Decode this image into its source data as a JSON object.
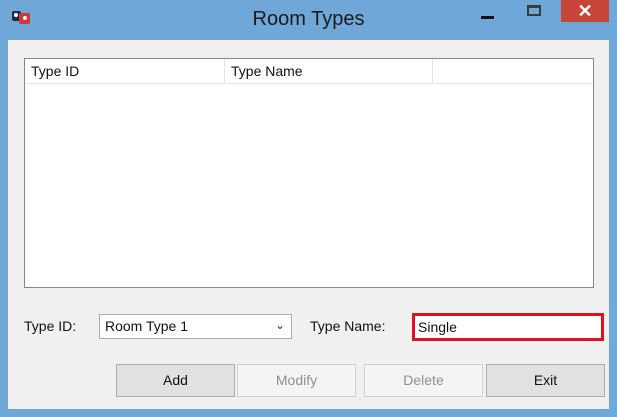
{
  "window": {
    "title": "Room Types",
    "close_glyph": "✕",
    "icon": "app-icon"
  },
  "listview": {
    "columns": [
      "Type ID",
      "Type Name",
      ""
    ],
    "rows": []
  },
  "form": {
    "type_id_label": "Type ID:",
    "type_id_value": "Room Type 1",
    "type_name_label": "Type Name:",
    "type_name_value": "Single",
    "dropdown_glyph": "⌄"
  },
  "buttons": {
    "add": "Add",
    "modify": "Modify",
    "delete": "Delete",
    "exit": "Exit"
  },
  "colors": {
    "title_bar": "#6fa8d8",
    "close_button": "#c7453a",
    "highlight_border": "#e01020"
  }
}
